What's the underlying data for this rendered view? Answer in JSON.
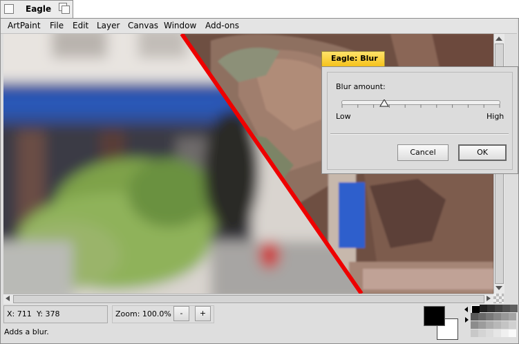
{
  "window": {
    "title": "Eagle"
  },
  "menubar": {
    "items": [
      "ArtPaint",
      "File",
      "Edit",
      "Layer",
      "Canvas",
      "Window",
      "Add-ons"
    ]
  },
  "statusbar": {
    "x_label": "X: 711",
    "y_label": "Y: 378",
    "zoom_label": "Zoom: 100.0%",
    "zoom_out_label": "-",
    "zoom_in_label": "+",
    "message": "Adds a blur."
  },
  "colors": {
    "foreground": "#000000",
    "background": "#ffffff",
    "dialog_tab": "#f7c928",
    "divider_line": "#ee0000"
  },
  "dialog": {
    "title": "Eagle: Blur",
    "blur_label": "Blur amount:",
    "low_label": "Low",
    "high_label": "High",
    "blur_amount_fraction": 0.27,
    "cancel_label": "Cancel",
    "ok_label": "OK"
  }
}
